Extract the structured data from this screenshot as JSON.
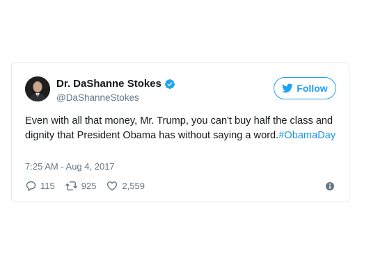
{
  "tweet": {
    "author_name": "Dr. DaShanne Stokes",
    "author_handle": "@DaShanneStokes",
    "follow_label": "Follow",
    "text": "Even with all that money, Mr. Trump, you can't buy half the class and dignity that President Obama has without saying a word.",
    "hashtag": "#ObamaDay",
    "timestamp": "7:25 AM - Aug 4, 2017",
    "replies": "115",
    "retweets": "925",
    "likes": "2,559"
  },
  "colors": {
    "accent": "#1da1f2",
    "link": "#1b95e0",
    "muted": "#657786",
    "border": "#e1e8ed"
  },
  "icons": [
    "verified-badge-icon",
    "twitter-bird-icon",
    "reply-icon",
    "retweet-icon",
    "like-icon",
    "info-icon"
  ]
}
